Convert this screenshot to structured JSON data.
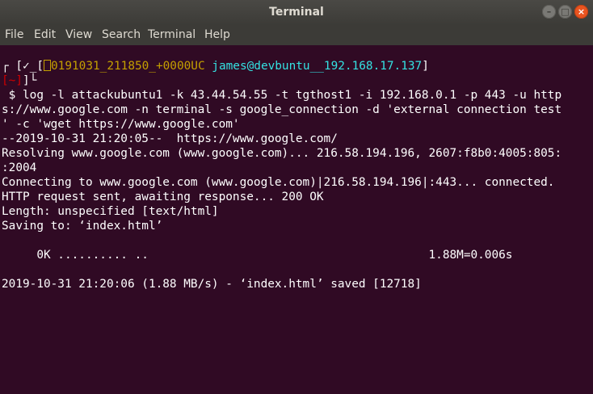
{
  "window": {
    "title": "Terminal",
    "buttons": {
      "minimize": "–",
      "maximize": "□",
      "close": "×"
    }
  },
  "menubar": {
    "items": [
      "File",
      "Edit",
      "View",
      "Search",
      "Terminal",
      "Help"
    ]
  },
  "prompt": {
    "corner_top": "┌",
    "bracket_open": "[",
    "check": "✓",
    "bracket_sep": "_[",
    "timestamp": "0191031_211850_+0000UC",
    "user_host": "james@devbuntu__192.168.17.137",
    "bracket_close": "]",
    "dir": "[~]",
    "corner_bottom": "└",
    "symbol": "$"
  },
  "output_lines": [
    " $ log -l attackubuntu1 -k 43.44.54.55 -t tgthost1 -i 192.168.0.1 -p 443 -u http",
    "s://www.google.com -n terminal -s google_connection -d 'external connection test",
    "' -c 'wget https://www.google.com'",
    "--2019-10-31 21:20:05--  https://www.google.com/",
    "Resolving www.google.com (www.google.com)... 216.58.194.196, 2607:f8b0:4005:805:",
    ":2004",
    "Connecting to www.google.com (www.google.com)|216.58.194.196|:443... connected.",
    "HTTP request sent, awaiting response... 200 OK",
    "Length: unspecified [text/html]",
    "Saving to: ‘index.html’",
    "",
    "     0K .......... ..                                        1.88M=0.006s",
    "",
    "2019-10-31 21:20:06 (1.88 MB/s) - ‘index.html’ saved [12718]"
  ],
  "colors": {
    "background": "#300a24",
    "text": "#ffffff",
    "user_host": "#34e2e2",
    "dir": "#cc0000",
    "close_button": "#e95420"
  }
}
